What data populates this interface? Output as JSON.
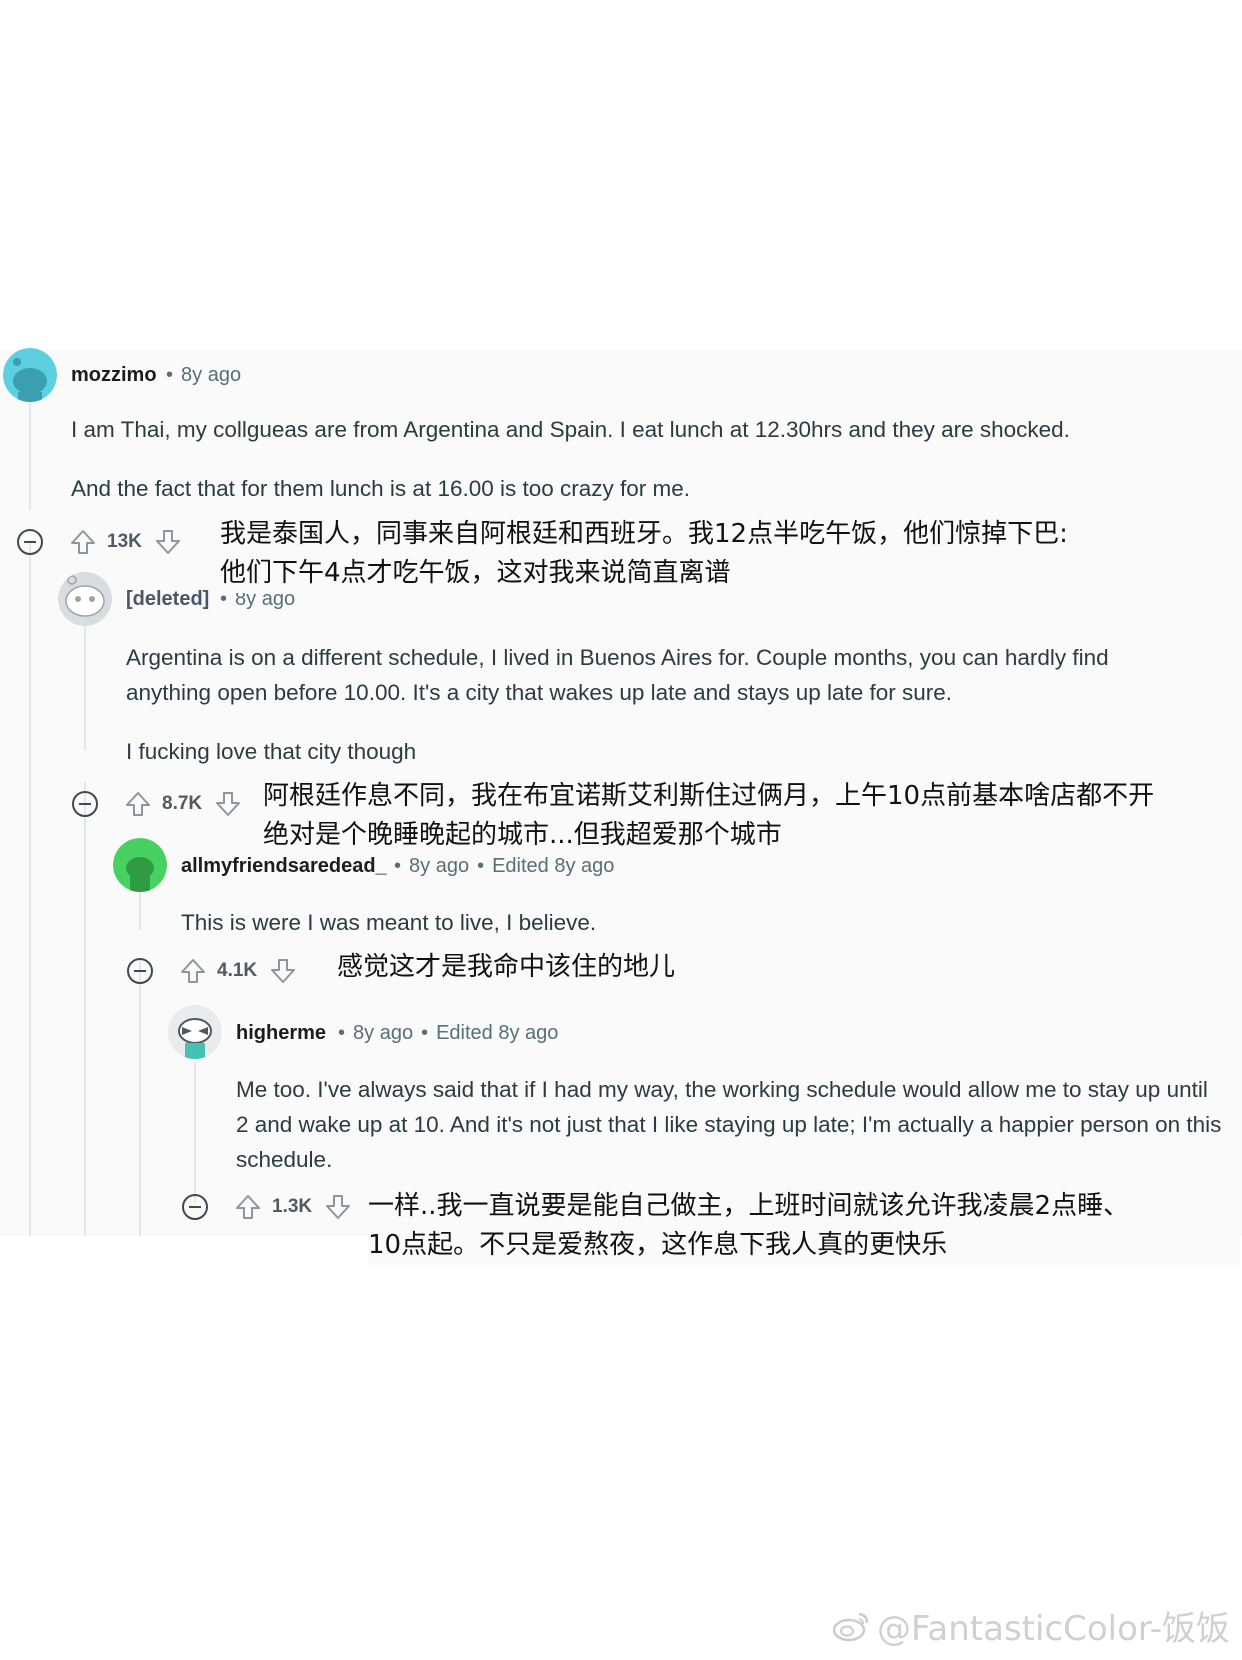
{
  "comments": [
    {
      "username": "mozzimo",
      "time": "8y ago",
      "edited": "",
      "body": [
        "I am Thai, my collgueas are from Argentina and Spain. I eat lunch at 12.30hrs and they are shocked.",
        "And the fact that for them lunch is at 16.00 is too crazy for me."
      ],
      "votes": "13K",
      "translation": [
        "我是泰国人，同事来自阿根廷和西班牙。我12点半吃午饭，他们惊掉下巴:",
        "他们下午4点才吃午饭，这对我来说简直离谱"
      ],
      "avatar_color": "#5ccfe0"
    },
    {
      "username": "[deleted]",
      "time": "8y ago",
      "edited": "",
      "body": [
        "Argentina is on a different schedule, I lived in Buenos Aires for. Couple months, you can hardly find anything open before 10.00. It's a city that wakes up late and stays up late for sure.",
        "I fucking love that city though"
      ],
      "votes": "8.7K",
      "translation": [
        "阿根廷作息不同，我在布宜诺斯艾利斯住过俩月，上午10点前基本啥店都不开",
        "绝对是个晚睡晚起的城市...但我超爱那个城市"
      ],
      "avatar_color": "#d9dde0"
    },
    {
      "username": "allmyfriendsaredead_",
      "time": "8y ago",
      "edited": "Edited 8y ago",
      "body": [
        "This is were I was meant to live, I believe."
      ],
      "votes": "4.1K",
      "translation": [
        "感觉这才是我命中该住的地儿"
      ],
      "avatar_color": "#46d160"
    },
    {
      "username": "higherme",
      "time": "8y ago",
      "edited": "Edited 8y ago",
      "body": [
        "Me too. I've always said that if I had my way, the working schedule would allow me to stay up until 2 and wake up at 10. And it's not just that I like staying up late; I'm actually a happier person on this schedule."
      ],
      "votes": "1.3K",
      "translation": [
        "一样..我一直说要是能自己做主，上班时间就该允许我凌晨2点睡、",
        "10点起。不只是爱熬夜，这作息下我人真的更快乐"
      ],
      "avatar_color": "#e8ecee"
    }
  ],
  "icons": {
    "upvote": "upvote-arrow-icon",
    "downvote": "downvote-arrow-icon",
    "collapse": "collapse-minus-icon",
    "weibo": "weibo-logo-icon"
  },
  "watermark": "@FantasticColor-饭饭"
}
